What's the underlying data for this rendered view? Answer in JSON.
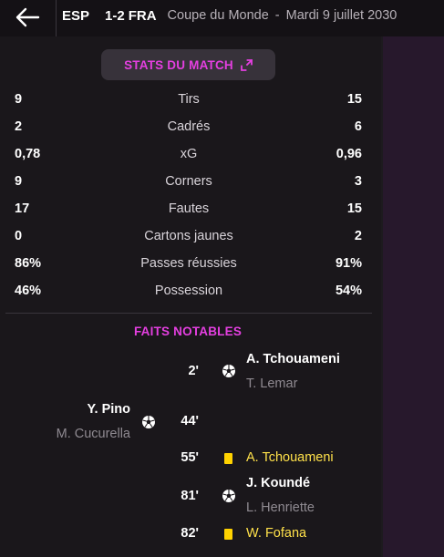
{
  "header": {
    "home_team": "ESP",
    "score": "1-2",
    "away_team": "FRA",
    "competition": "Coupe du Monde",
    "separator": "-",
    "date": "Mardi 9 juillet 2030"
  },
  "stats_button": {
    "label": "STATS DU MATCH",
    "icon": "expand-icon"
  },
  "stats": [
    {
      "label": "Tirs",
      "home": "9",
      "away": "15"
    },
    {
      "label": "Cadrés",
      "home": "2",
      "away": "6"
    },
    {
      "label": "xG",
      "home": "0,78",
      "away": "0,96"
    },
    {
      "label": "Corners",
      "home": "9",
      "away": "3"
    },
    {
      "label": "Fautes",
      "home": "17",
      "away": "15"
    },
    {
      "label": "Cartons jaunes",
      "home": "0",
      "away": "2"
    },
    {
      "label": "Passes réussies",
      "home": "86%",
      "away": "91%"
    },
    {
      "label": "Possession",
      "home": "46%",
      "away": "54%"
    }
  ],
  "facts": {
    "title": "FAITS NOTABLES",
    "events": [
      {
        "minute": "2'",
        "side": "away",
        "type": "goal",
        "icon": "ball-icon",
        "player": "A. Tchouameni",
        "assist": "T. Lemar"
      },
      {
        "minute": "44'",
        "side": "home",
        "type": "goal",
        "icon": "ball-icon",
        "player": "Y. Pino",
        "assist": "M. Cucurella"
      },
      {
        "minute": "55'",
        "side": "away",
        "type": "yellow-card",
        "icon": "yellow-card-icon",
        "player": "A. Tchouameni"
      },
      {
        "minute": "81'",
        "side": "away",
        "type": "goal",
        "icon": "ball-icon",
        "player": "J. Koundé",
        "assist": "L. Henriette"
      },
      {
        "minute": "82'",
        "side": "away",
        "type": "yellow-card",
        "icon": "yellow-card-icon",
        "player": "W. Fofana"
      }
    ]
  },
  "colors": {
    "accent": "#e43fe0",
    "background": "#1a171b",
    "side_panel": "#27182c",
    "yellow_card": "#ffd200",
    "yellow_text": "#ffe14a"
  }
}
